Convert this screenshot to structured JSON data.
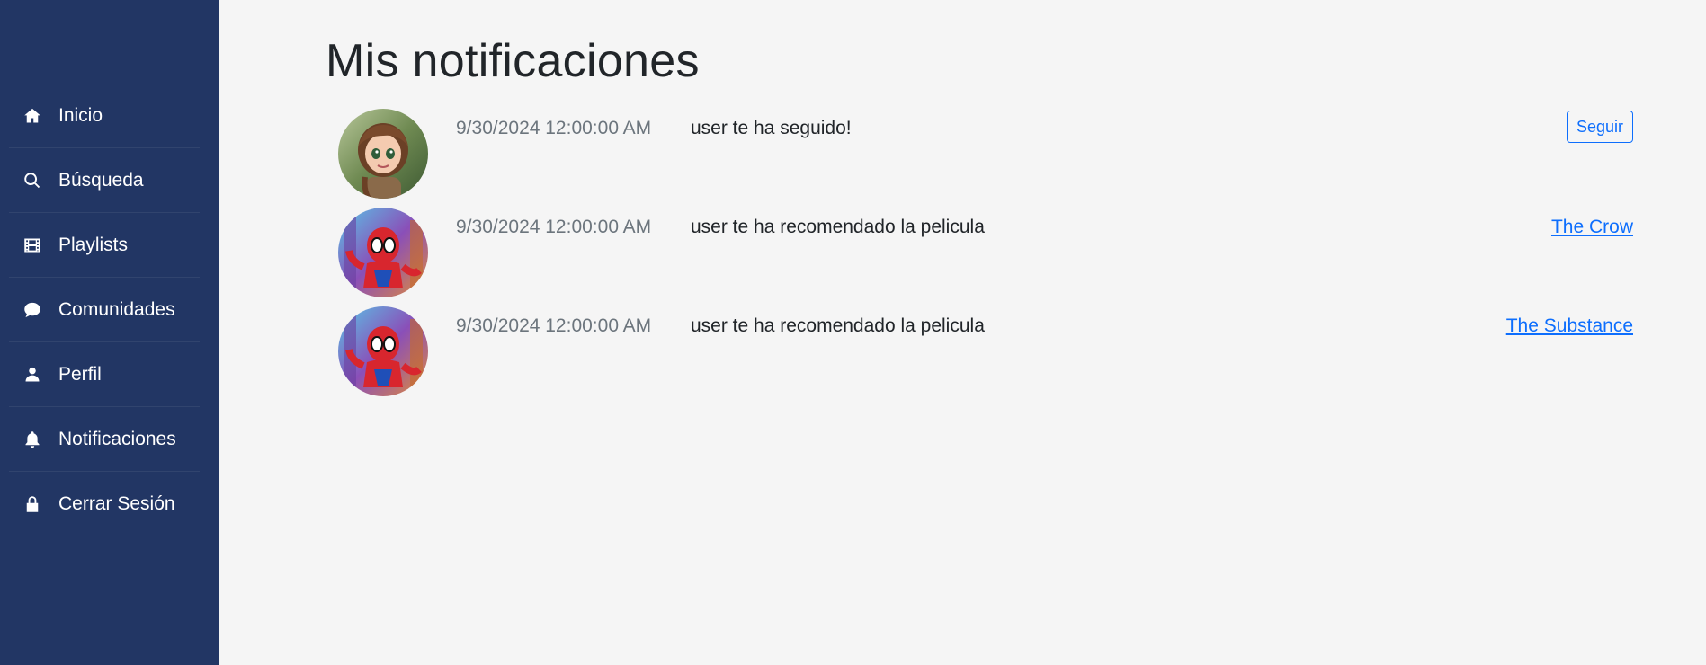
{
  "sidebar": {
    "items": [
      {
        "label": "Inicio",
        "icon": "home-icon"
      },
      {
        "label": "Búsqueda",
        "icon": "search-icon"
      },
      {
        "label": "Playlists",
        "icon": "film-icon"
      },
      {
        "label": "Comunidades",
        "icon": "chat-bubble-icon"
      },
      {
        "label": "Perfil",
        "icon": "person-icon"
      },
      {
        "label": "Notificaciones",
        "icon": "bell-icon"
      },
      {
        "label": "Cerrar Sesión",
        "icon": "lock-icon"
      }
    ]
  },
  "main": {
    "title": "Mis notificaciones",
    "notifications": [
      {
        "date": "9/30/2024 12:00:00 AM",
        "message": "user te ha seguido!",
        "action": "Seguir",
        "action_type": "button",
        "avatar": "girl-avatar"
      },
      {
        "date": "9/30/2024 12:00:00 AM",
        "message": "user te ha recomendado la pelicula",
        "action": "The Crow",
        "action_type": "link",
        "avatar": "spiderman-avatar"
      },
      {
        "date": "9/30/2024 12:00:00 AM",
        "message": "user te ha recomendado la pelicula",
        "action": "The Substance",
        "action_type": "link",
        "avatar": "spiderman-avatar"
      }
    ]
  },
  "colors": {
    "sidebar_bg": "#223664",
    "page_bg": "#f5f5f5",
    "accent": "#0d6efd",
    "muted_text": "#6c757d"
  }
}
